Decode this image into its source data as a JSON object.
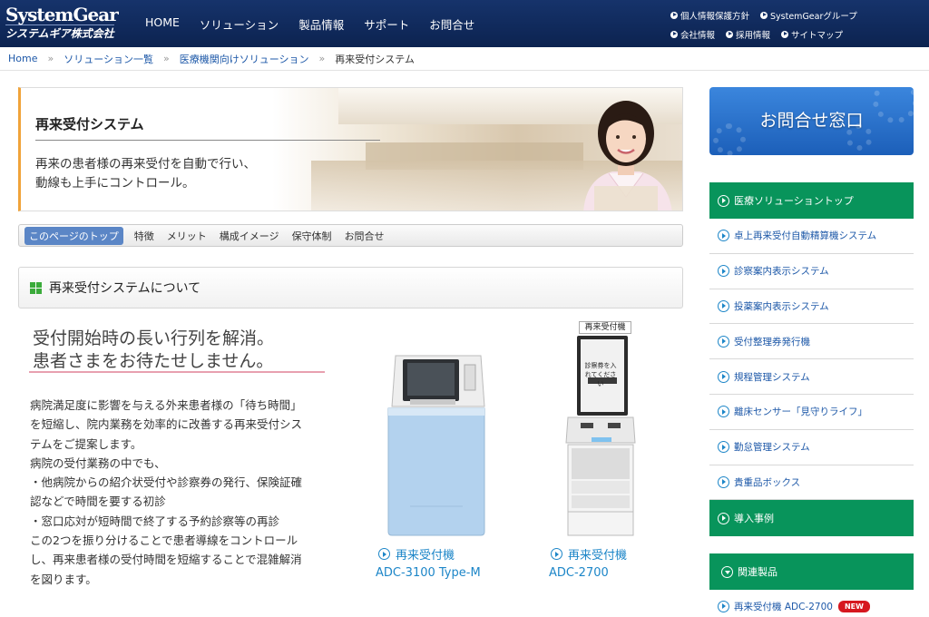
{
  "brand": {
    "logo_top": "SystemGear",
    "logo_bottom": "システムギア株式会社"
  },
  "global_nav": [
    "HOME",
    "ソリューション",
    "製品情報",
    "サポート",
    "お問合せ"
  ],
  "utility_nav": {
    "row1": [
      "個人情報保護方針",
      "SystemGearグループ"
    ],
    "row2": [
      "会社情報",
      "採用情報",
      "サイトマップ"
    ]
  },
  "breadcrumb": {
    "home": "Home",
    "sep": "»",
    "level1": "ソリューション一覧",
    "level2": "医療機関向けソリューション",
    "current": "再来受付システム"
  },
  "hero": {
    "title": "再来受付システム",
    "desc_line1": "再来の患者様の再来受付を自動で行い、",
    "desc_line2": "動線も上手にコントロール。"
  },
  "page_tabs": [
    "このページのトップ",
    "特徴",
    "メリット",
    "構成イメージ",
    "保守体制",
    "お問合せ"
  ],
  "section": {
    "title": "再来受付システムについて"
  },
  "catch": {
    "line1": "受付開始時の長い行列を解消。",
    "line2": "患者さまをお待たせしません。"
  },
  "body_lines": [
    "病院満足度に影響を与える外来患者様の「待ち時間」",
    "を短縮し、院内業務を効率的に改善する再来受付シス",
    "テムをご提案します。",
    "病院の受付業務の中でも、",
    "・他病院からの紹介状受付や診察券の発行、保険証確",
    "認などで時間を要する初診",
    "・窓口応対が短時間で終了する予約診察等の再診",
    "この2つを振り分けることで患者導線をコントロール",
    "し、再来患者様の受付時間を短縮することで混雑解消",
    "を図ります。"
  ],
  "products": [
    {
      "link": "再来受付機",
      "model": "ADC-3100 Type-M"
    },
    {
      "link": "再来受付機",
      "model": "ADC-2700"
    }
  ],
  "kiosk_label": "再来受付機",
  "kiosk_screen": "診察券を入れてください",
  "contact_banner": "お問合せ窓口",
  "sidebar": {
    "head": "医療ソリューショントップ",
    "items": [
      "卓上再来受付自動精算機システム",
      "診察案内表示システム",
      "投薬案内表示システム",
      "受付整理券発行機",
      "規程管理システム",
      "離床センサー「見守りライフ」",
      "勤怠管理システム",
      "貴重品ボックス"
    ],
    "cases": "導入事例"
  },
  "related": {
    "head": "関連製品",
    "item": "再来受付機 ADC-2700",
    "badge": "NEW"
  },
  "colors": {
    "header": "#16336b",
    "accent_green": "#08945b",
    "link": "#1d58a8",
    "hero_bar": "#f0a33a"
  }
}
